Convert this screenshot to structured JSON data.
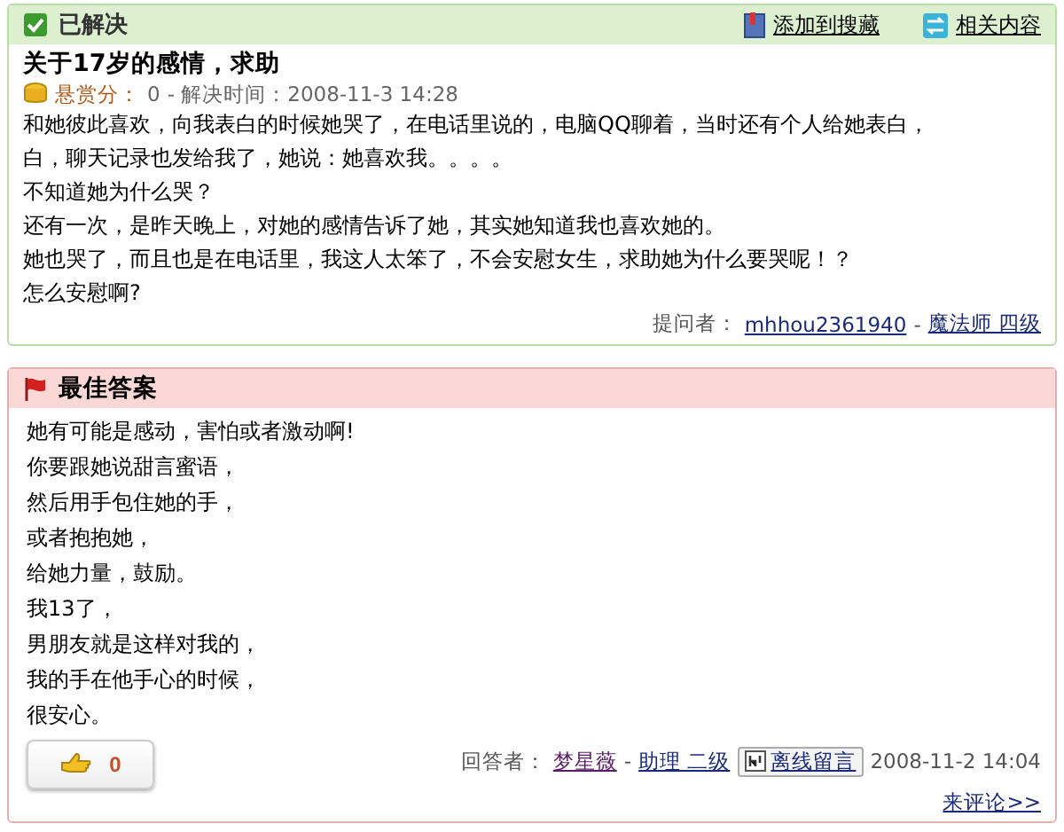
{
  "status": "已解决",
  "header_links": [
    {
      "kind": "bookmark",
      "label": "添加到搜藏"
    },
    {
      "kind": "related",
      "label": "相关内容"
    }
  ],
  "question": {
    "title": "关于17岁的感情，求助",
    "reward_label": "悬赏分：",
    "reward": "0",
    "solved_label": "- 解决时间：2008-11-3 14:28",
    "lines": [
      "和她彼此喜欢，向我表白的时候她哭了，在电话里说的，电脑QQ聊着，当时还有个人给她表白，",
      "白，聊天记录也发给我了，她说：她喜欢我。。。。",
      "不知道她为什么哭？",
      "还有一次，是昨天晚上，对她的感情告诉了她，其实她知道我也喜欢她的。",
      "她也哭了，而且也是在电话里，我这人太笨了，不会安慰女生，求助她为什么要哭呢！？",
      "怎么安慰啊?"
    ],
    "asker_label": "提问者：",
    "asker": "mhhou2361940",
    "asker_sep": "-",
    "asker_rank": "魔法师 四级"
  },
  "answer": {
    "title": "最佳答案",
    "lines": [
      "她有可能是感动，害怕或者激动啊!",
      "你要跟她说甜言蜜语，",
      "然后用手包住她的手，",
      "或者抱抱她，",
      "给她力量，鼓励。",
      "我13了，",
      "男朋友就是这样对我的，",
      "我的手在他手心的时候，",
      "很安心。"
    ],
    "likes": "0",
    "answerer_label": "回答者：",
    "answerer": "梦星薇",
    "answerer_sep": "-",
    "answerer_rank": "助理 二级",
    "message_button": "离线留言",
    "time": "2008-11-2 14:04",
    "comment_link": "来评论>>"
  }
}
